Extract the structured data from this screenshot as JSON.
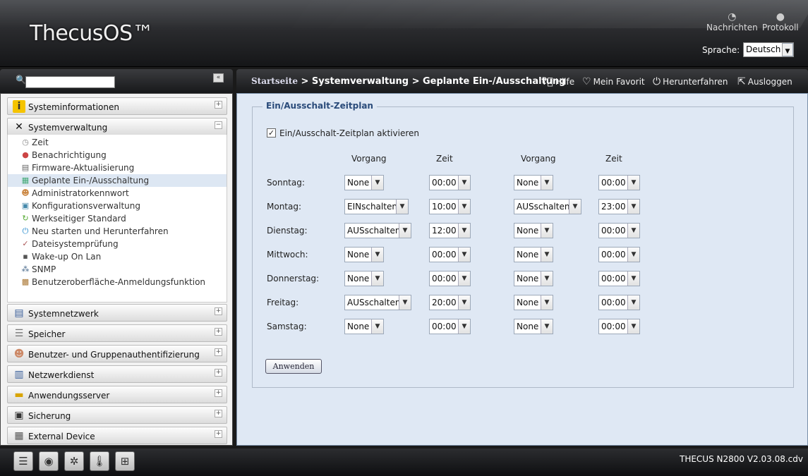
{
  "header": {
    "logo": "ThecusOS™",
    "news_label": "Nachrichten",
    "log_label": "Protokoll",
    "language_label": "Sprache:",
    "language_value": "Deutsch"
  },
  "sidebar": {
    "categories_top": [
      {
        "label": "Systeminformationen",
        "icon": "info-icon",
        "toggle": "+"
      },
      {
        "label": "Systemverwaltung",
        "icon": "tools-icon",
        "toggle": "−"
      }
    ],
    "subitems": [
      {
        "label": "Zeit",
        "icon": "clock-icon"
      },
      {
        "label": "Benachrichtigung",
        "icon": "notification-icon"
      },
      {
        "label": "Firmware-Aktualisierung",
        "icon": "firmware-icon"
      },
      {
        "label": "Geplante Ein-/Ausschaltung",
        "icon": "schedule-icon",
        "active": true
      },
      {
        "label": "Administratorkennwort",
        "icon": "user-key-icon"
      },
      {
        "label": "Konfigurationsverwaltung",
        "icon": "config-icon"
      },
      {
        "label": "Werkseitiger Standard",
        "icon": "reset-icon"
      },
      {
        "label": "Neu starten und Herunterfahren",
        "icon": "power-icon"
      },
      {
        "label": "Dateisystemprüfung",
        "icon": "check-icon"
      },
      {
        "label": "Wake-up On Lan",
        "icon": "network-icon"
      },
      {
        "label": "SNMP",
        "icon": "snmp-icon"
      },
      {
        "label": "Benutzeroberfläche-Anmeldungsfunktion",
        "icon": "login-icon"
      }
    ],
    "categories_bottom": [
      {
        "label": "Systemnetzwerk",
        "icon": "network-icon",
        "toggle": "+"
      },
      {
        "label": "Speicher",
        "icon": "storage-icon",
        "toggle": "+"
      },
      {
        "label": "Benutzer- und Gruppenauthentifizierung",
        "icon": "users-icon",
        "toggle": "+"
      },
      {
        "label": "Netzwerkdienst",
        "icon": "service-icon",
        "toggle": "+"
      },
      {
        "label": "Anwendungsserver",
        "icon": "folder-icon",
        "toggle": "+"
      },
      {
        "label": "Sicherung",
        "icon": "backup-icon",
        "toggle": "+"
      },
      {
        "label": "External Device",
        "icon": "device-icon",
        "toggle": "+"
      }
    ]
  },
  "toolbar": {
    "breadcrumb_home": "Startseite",
    "breadcrumb_rest": " > Systemverwaltung > Geplante Ein-/Ausschaltung",
    "help": "Hilfe",
    "favorite": "Mein Favorit",
    "shutdown": "Herunterfahren",
    "logout": "Ausloggen"
  },
  "schedule": {
    "legend": "Ein/Ausschalt-Zeitplan",
    "enable_label": "Ein/Ausschalt-Zeitplan aktivieren",
    "enabled": true,
    "col_action": "Vorgang",
    "col_time": "Zeit",
    "rows": [
      {
        "day": "Sonntag:",
        "a1": "None",
        "t1": "00:00",
        "a2": "None",
        "t2": "00:00"
      },
      {
        "day": "Montag:",
        "a1": "EINschalten",
        "t1": "10:00",
        "a2": "AUSschalten",
        "t2": "23:00"
      },
      {
        "day": "Dienstag:",
        "a1": "AUSschalten",
        "t1": "12:00",
        "a2": "None",
        "t2": "00:00"
      },
      {
        "day": "Mittwoch:",
        "a1": "None",
        "t1": "00:00",
        "a2": "None",
        "t2": "00:00"
      },
      {
        "day": "Donnerstag:",
        "a1": "None",
        "t1": "00:00",
        "a2": "None",
        "t2": "00:00"
      },
      {
        "day": "Freitag:",
        "a1": "AUSschalten",
        "t1": "20:00",
        "a2": "None",
        "t2": "00:00"
      },
      {
        "day": "Samstag:",
        "a1": "None",
        "t1": "00:00",
        "a2": "None",
        "t2": "00:00"
      }
    ],
    "apply_label": "Anwenden"
  },
  "footer": {
    "version": "THECUS N2800 V2.03.08.cdv",
    "icons": [
      "server-icon",
      "disk-icon",
      "fan-icon",
      "temperature-icon",
      "lan-icon"
    ]
  }
}
